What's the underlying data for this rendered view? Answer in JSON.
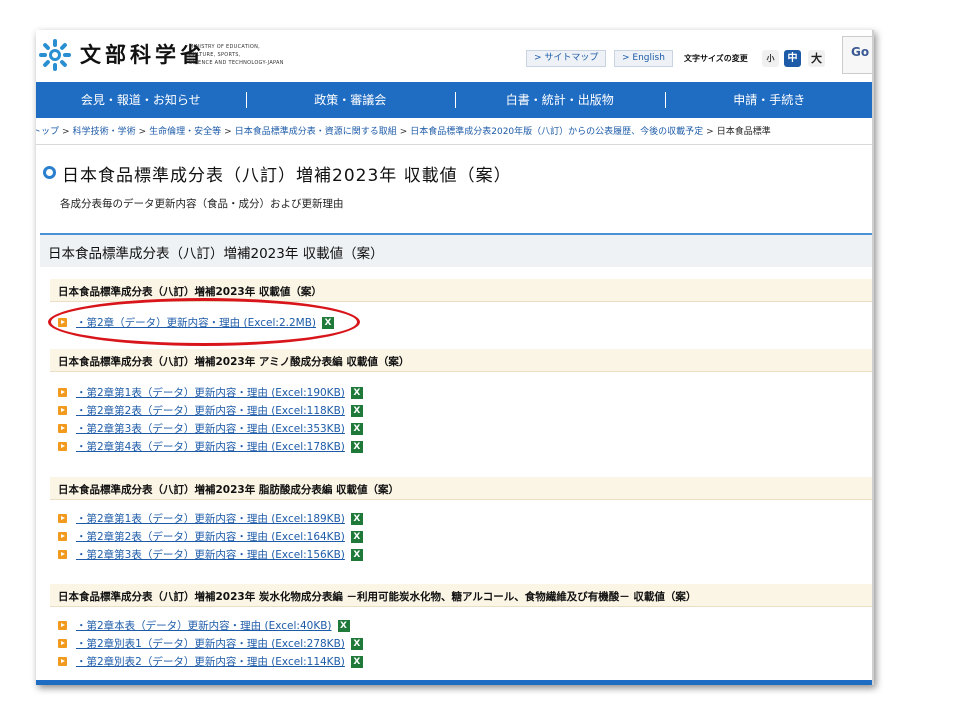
{
  "header": {
    "logo_jp": "文部科学省",
    "logo_en": [
      "MINISTRY OF EDUCATION,",
      "CULTURE, SPORTS,",
      "SCIENCE AND TECHNOLOGY-JAPAN"
    ],
    "sitemap_label": "> サイトマップ",
    "english_label": "> English",
    "font_size_label": "文字サイズの変更",
    "font_small": "小",
    "font_medium": "中",
    "font_large": "大",
    "search_text": "Go"
  },
  "nav": {
    "items": [
      "会見・報道・お知らせ",
      "政策・審議会",
      "白書・統計・出版物",
      "申請・手続き"
    ]
  },
  "breadcrumb": {
    "items": [
      "トップ",
      "科学技術・学術",
      "生命倫理・安全等",
      "日本食品標準成分表・資源に関する取組",
      "日本食品標準成分表2020年版（八訂）からの公表履歴、今後の収載予定",
      "日本食品標準"
    ]
  },
  "page": {
    "title": "日本食品標準成分表（八訂）増補2023年 収載値（案）",
    "subtitle": "各成分表毎のデータ更新内容（食品・成分）および更新理由",
    "section_title": "日本食品標準成分表（八訂）増補2023年 収載値（案）"
  },
  "groups": [
    {
      "heading": "日本食品標準成分表（八訂）増補2023年 収載値（案）",
      "files": [
        "・第2章（データ）更新内容・理由 (Excel:2.2MB)"
      ]
    },
    {
      "heading": "日本食品標準成分表（八訂）増補2023年 アミノ酸成分表編 収載値（案）",
      "files": [
        "・第2章第1表（データ）更新内容・理由 (Excel:190KB)",
        "・第2章第2表（データ）更新内容・理由 (Excel:118KB)",
        "・第2章第3表（データ）更新内容・理由 (Excel:353KB)",
        "・第2章第4表（データ）更新内容・理由 (Excel:178KB)"
      ]
    },
    {
      "heading": "日本食品標準成分表（八訂）増補2023年 脂肪酸成分表編 収載値（案）",
      "files": [
        "・第2章第1表（データ）更新内容・理由 (Excel:189KB)",
        "・第2章第2表（データ）更新内容・理由 (Excel:164KB)",
        "・第2章第3表（データ）更新内容・理由 (Excel:156KB)"
      ]
    },
    {
      "heading": "日本食品標準成分表（八訂）増補2023年 炭水化物成分表編 －利用可能炭水化物、糖アルコール、食物繊維及び有機酸－ 収載値（案）",
      "files": [
        "・第2章本表（データ）更新内容・理由 (Excel:40KB)",
        "・第2章別表1（データ）更新内容・理由 (Excel:278KB)",
        "・第2章別表2（データ）更新内容・理由 (Excel:114KB)"
      ]
    }
  ],
  "icons": {
    "excel_glyph": "X"
  },
  "colors": {
    "nav_blue": "#1f6cc3",
    "link_blue": "#1d5ba8",
    "bullet_orange": "#f29a1d",
    "excel_green": "#1f7a3a",
    "highlight_red": "#d8151b"
  }
}
